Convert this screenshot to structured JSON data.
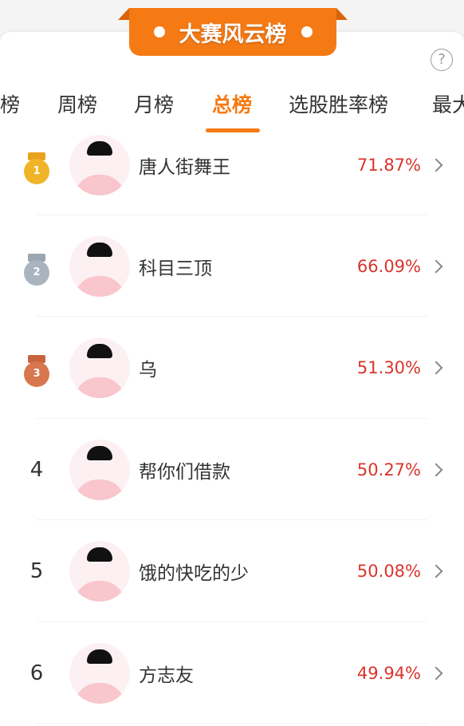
{
  "banner": {
    "title": "大赛风云榜"
  },
  "help_icon": "?",
  "tabs": [
    "榜",
    "周榜",
    "月榜",
    "总榜",
    "选股胜率榜",
    "最大"
  ],
  "active_tab": "总榜",
  "accent": "#f57a14",
  "rows": [
    {
      "rank": "1",
      "medal": "gold",
      "name": "唐人街舞王",
      "value": "71.87%"
    },
    {
      "rank": "2",
      "medal": "silver",
      "name": "科目三顶",
      "value": "66.09%"
    },
    {
      "rank": "3",
      "medal": "bronze",
      "name": "乌",
      "value": "51.30%"
    },
    {
      "rank": "4",
      "name": "帮你们借款",
      "value": "50.27%"
    },
    {
      "rank": "5",
      "name": "饿的快吃的少",
      "value": "50.08%"
    },
    {
      "rank": "6",
      "name": "方志友",
      "value": "49.94%"
    }
  ]
}
